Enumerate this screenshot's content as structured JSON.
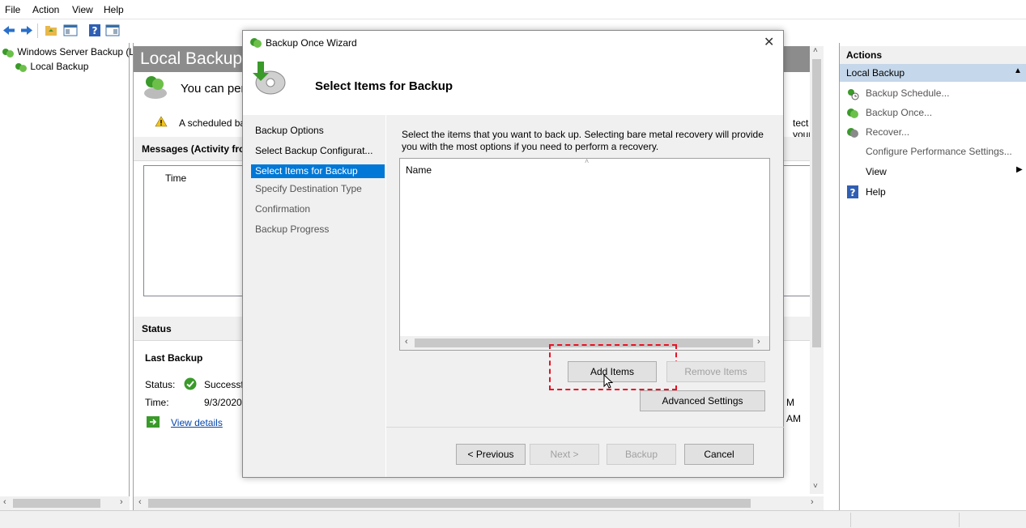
{
  "menu": [
    "File",
    "Action",
    "View",
    "Help"
  ],
  "tree": {
    "root": "Windows Server Backup (L",
    "child": "Local Backup"
  },
  "main": {
    "title": "Local Backup",
    "intro": "You can per",
    "warning": "A scheduled ba",
    "warning_right": "tect your",
    "messages_header": "Messages (Activity fro",
    "time_col": "Time",
    "status_header": "Status",
    "last_backup": "Last Backup",
    "status_label": "Status:",
    "status_value": "Successfu",
    "time_label": "Time:",
    "time_value": "9/3/2020",
    "view_details": "View details",
    "right_m": "M",
    "right_am": "AM"
  },
  "actions": {
    "header": "Actions",
    "selected": "Local Backup",
    "items": [
      {
        "label": "Backup Schedule...",
        "icon": "backup-schedule-icon",
        "dim": true
      },
      {
        "label": "Backup Once...",
        "icon": "backup-once-icon",
        "dim": true
      },
      {
        "label": "Recover...",
        "icon": "recover-icon",
        "dim": true
      },
      {
        "label": "Configure Performance Settings...",
        "icon": "",
        "dim": true
      },
      {
        "label": "View",
        "icon": "",
        "dim": false
      },
      {
        "label": "Help",
        "icon": "help-icon",
        "dim": false
      }
    ]
  },
  "wizard": {
    "title": "Backup Once Wizard",
    "heading": "Select Items for Backup",
    "nav": [
      {
        "label": "Backup Options",
        "state": "normal"
      },
      {
        "label": "Select Backup Configurat...",
        "state": "normal"
      },
      {
        "label": "Select Items for Backup",
        "state": "selected"
      },
      {
        "label": "Specify Destination Type",
        "state": "dim"
      },
      {
        "label": "Confirmation",
        "state": "dim"
      },
      {
        "label": "Backup Progress",
        "state": "dim"
      }
    ],
    "instructions": "Select the items that you want to back up. Selecting bare metal recovery will provide you with the most options if you need to perform a recovery.",
    "list_col": "Name",
    "add_items": "Add Items",
    "remove_items": "Remove Items",
    "advanced_settings": "Advanced Settings",
    "previous": "< Previous",
    "next": "Next >",
    "backup": "Backup",
    "cancel": "Cancel"
  },
  "colors": {
    "selection": "#0078d7",
    "highlight_box": "#e81123",
    "title_grey": "#8c8c8c"
  }
}
